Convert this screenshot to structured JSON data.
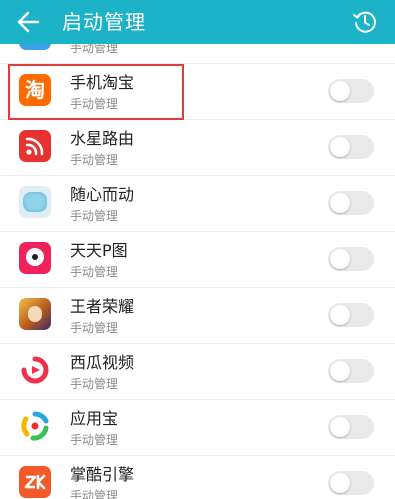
{
  "header": {
    "title": "启动管理",
    "back_icon": "back-arrow-icon",
    "history_icon": "history-clock-icon",
    "background": "#1cb3c9"
  },
  "partial_item": {
    "sub": "手动管理"
  },
  "apps": [
    {
      "name": "手机淘宝",
      "sub": "手动管理",
      "icon": "taobao-icon",
      "icon_text": "淘",
      "color": "#ff6a00"
    },
    {
      "name": "水星路由",
      "sub": "手动管理",
      "icon": "mercury-router-icon",
      "color": "#e8322f"
    },
    {
      "name": "随心而动",
      "sub": "手动管理",
      "icon": "suixin-icon",
      "color": "#8fd3e8"
    },
    {
      "name": "天天P图",
      "sub": "手动管理",
      "icon": "tiantian-ptu-icon",
      "color": "#f0225a"
    },
    {
      "name": "王者荣耀",
      "sub": "手动管理",
      "icon": "king-of-glory-icon",
      "color": "#c98a2a"
    },
    {
      "name": "西瓜视频",
      "sub": "手动管理",
      "icon": "xigua-video-icon",
      "color": "#f0304a"
    },
    {
      "name": "应用宝",
      "sub": "手动管理",
      "icon": "yingyongbao-icon",
      "color": "#2aa7e0"
    },
    {
      "name": "掌酷引擎",
      "sub": "手动管理",
      "icon": "zhangku-engine-icon",
      "color": "#f25a2a"
    }
  ],
  "highlight_color": "#e03c3c"
}
